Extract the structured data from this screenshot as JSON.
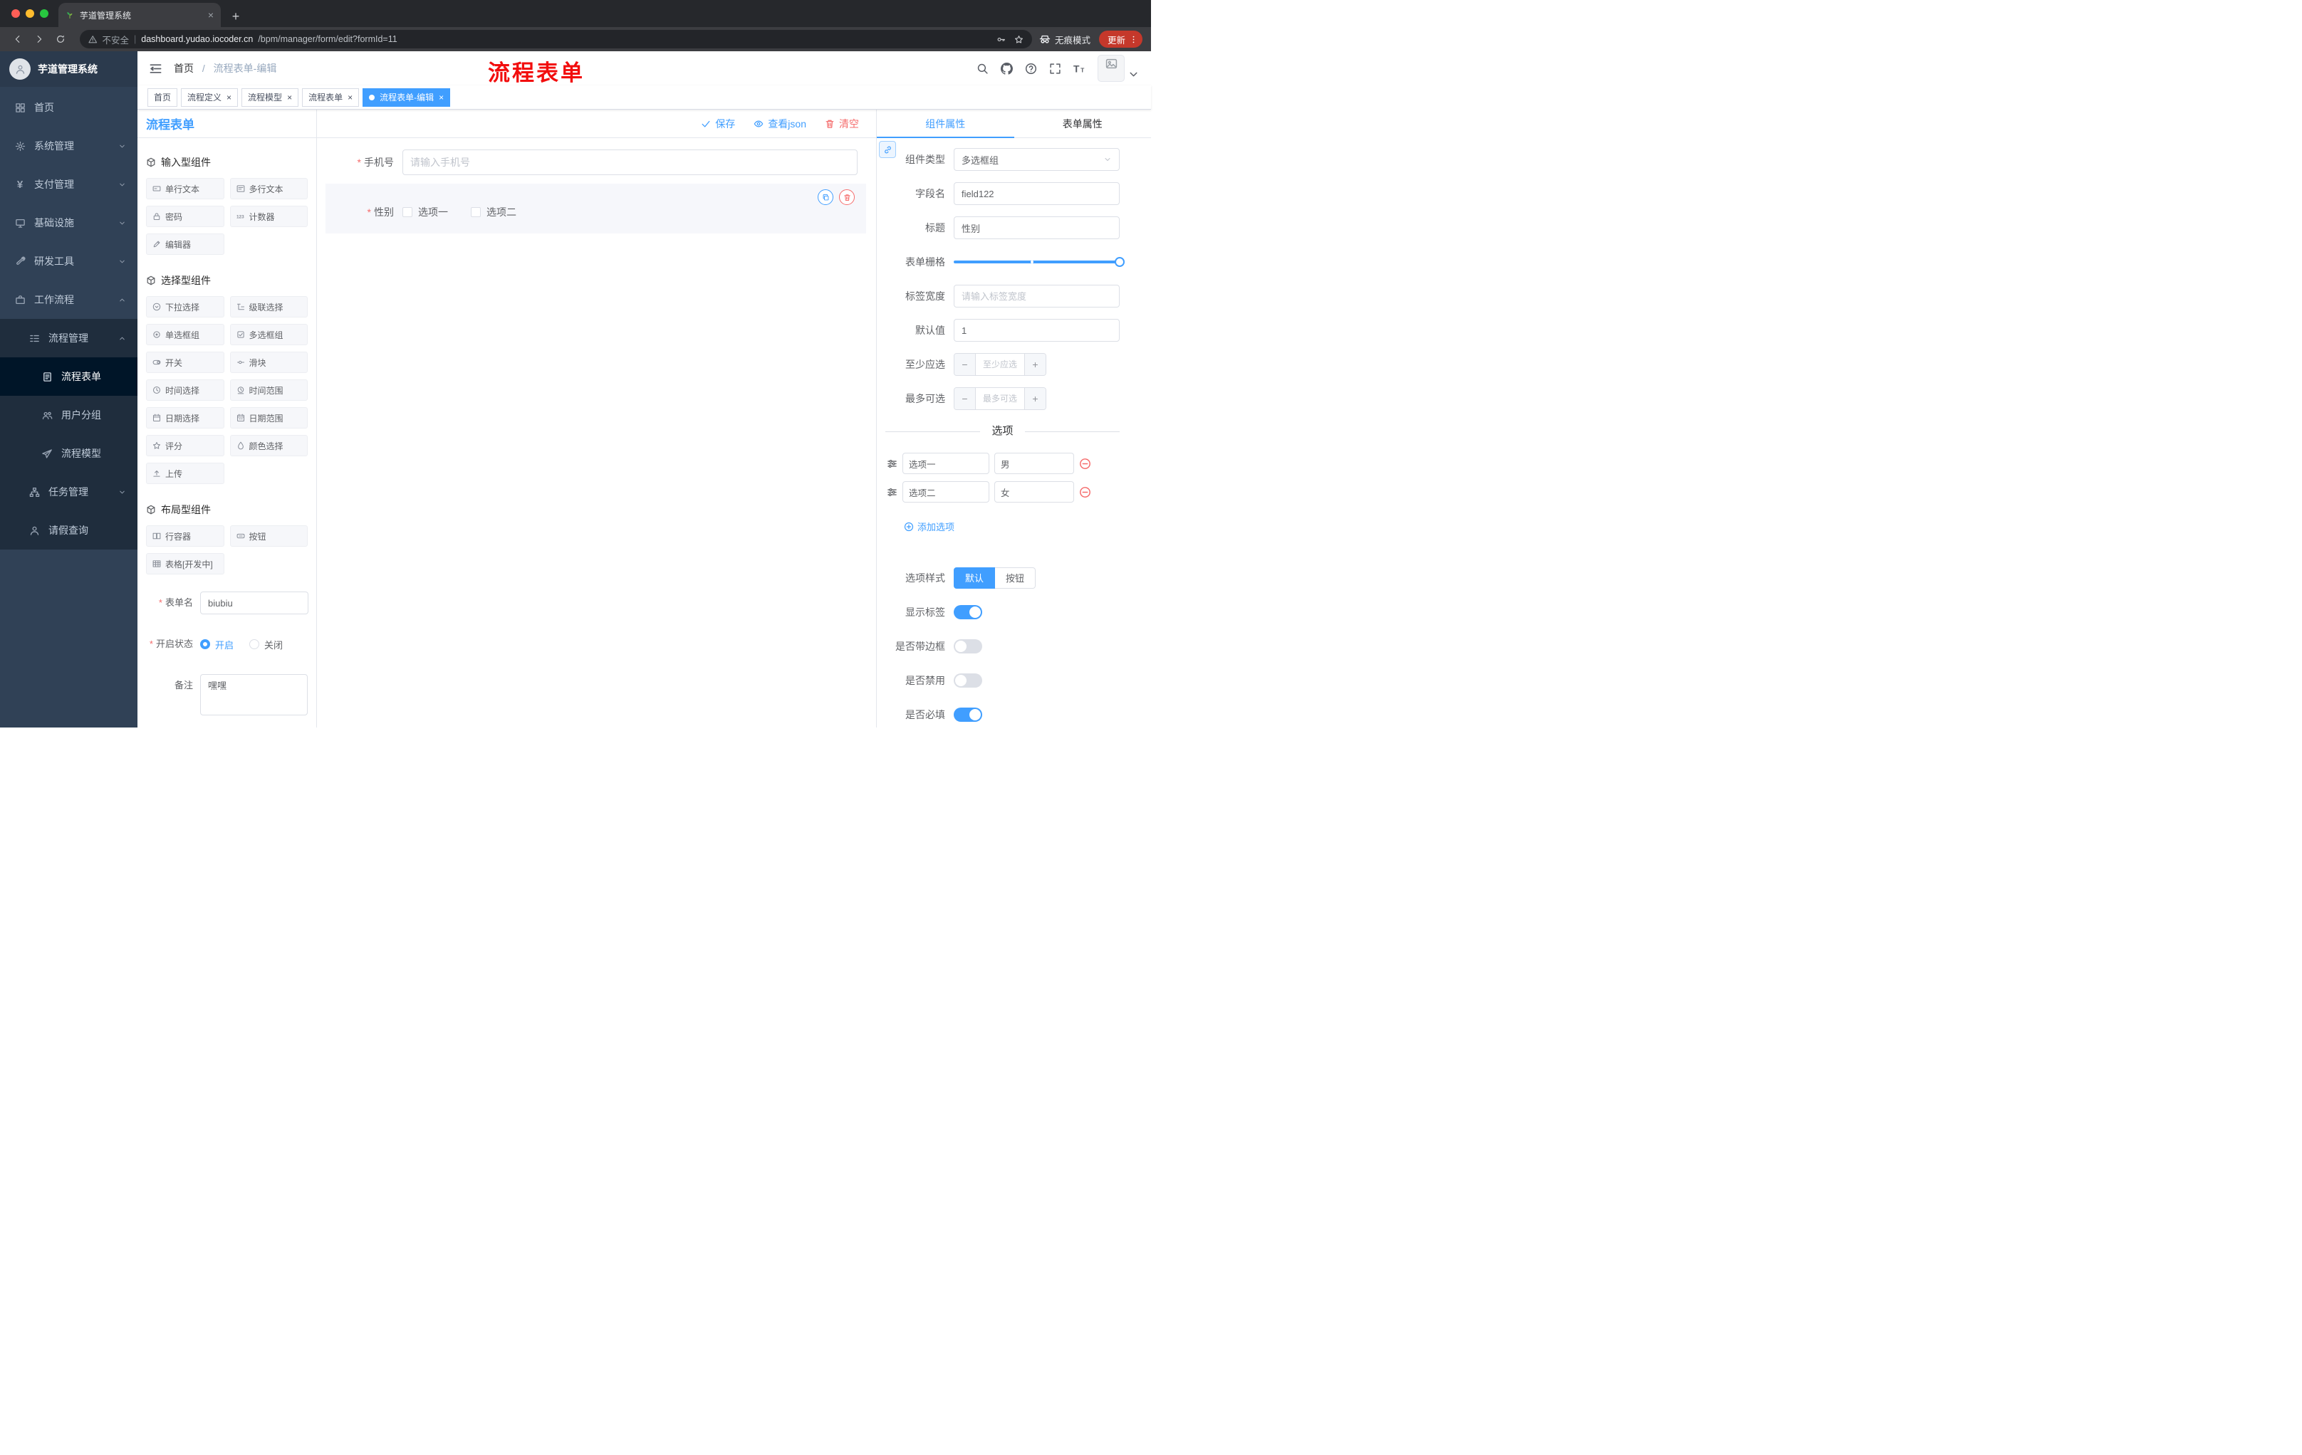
{
  "browser": {
    "tab": {
      "title": "芋道管理系统",
      "favicon": "plant-icon"
    },
    "address": {
      "security": "不安全",
      "url_domain": "dashboard.yudao.iocoder.cn",
      "url_path": "/bpm/manager/form/edit?formId=11"
    },
    "incognito_label": "无痕模式",
    "update_label": "更新"
  },
  "app_header": {
    "breadcrumb": {
      "home": "首页",
      "sep": "/",
      "current": "流程表单-编辑"
    },
    "annotation": "流程表单",
    "icons": [
      "search",
      "github",
      "help",
      "fullscreen",
      "font-size"
    ]
  },
  "tags_view": {
    "tags": [
      {
        "label": "首页",
        "closable": false,
        "active": false
      },
      {
        "label": "流程定义",
        "closable": true,
        "active": false
      },
      {
        "label": "流程模型",
        "closable": true,
        "active": false
      },
      {
        "label": "流程表单",
        "closable": true,
        "active": false
      },
      {
        "label": "流程表单-编辑",
        "closable": true,
        "active": true
      }
    ]
  },
  "sidebar": {
    "logo_title": "芋道管理系统",
    "menu": [
      {
        "label": "首页",
        "icon": "dashboard"
      },
      {
        "label": "系统管理",
        "icon": "gear",
        "expanded": false
      },
      {
        "label": "支付管理",
        "icon": "yen",
        "expanded": false
      },
      {
        "label": "基础设施",
        "icon": "infra",
        "expanded": false
      },
      {
        "label": "研发工具",
        "icon": "tools",
        "expanded": false
      },
      {
        "label": "工作流程",
        "icon": "workflow",
        "expanded": true
      },
      {
        "label": "流程管理",
        "icon": "process",
        "expanded": true
      },
      {
        "label": "流程表单",
        "icon": "form",
        "active": true
      },
      {
        "label": "用户分组",
        "icon": "users"
      },
      {
        "label": "流程模型",
        "icon": "model"
      },
      {
        "label": "任务管理",
        "icon": "tasks",
        "expanded": false
      },
      {
        "label": "请假查询",
        "icon": "person"
      }
    ]
  },
  "designer": {
    "title": "流程表单",
    "actions": {
      "save": "保存",
      "view_json": "查看json",
      "clear": "清空"
    },
    "palette": {
      "groups": [
        {
          "title": "输入型组件",
          "icon": "component",
          "items": [
            {
              "label": "单行文本",
              "icon": "text-field"
            },
            {
              "label": "多行文本",
              "icon": "textarea"
            },
            {
              "label": "密码",
              "icon": "password"
            },
            {
              "label": "计数器",
              "icon": "counter"
            },
            {
              "label": "编辑器",
              "icon": "editor"
            }
          ]
        },
        {
          "title": "选择型组件",
          "icon": "component",
          "items": [
            {
              "label": "下拉选择",
              "icon": "select"
            },
            {
              "label": "级联选择",
              "icon": "cascader"
            },
            {
              "label": "单选框组",
              "icon": "radio-group"
            },
            {
              "label": "多选框组",
              "icon": "checkbox-group"
            },
            {
              "label": "开关",
              "icon": "switch"
            },
            {
              "label": "滑块",
              "icon": "slider"
            },
            {
              "label": "时间选择",
              "icon": "time"
            },
            {
              "label": "时间范围",
              "icon": "time-range"
            },
            {
              "label": "日期选择",
              "icon": "date"
            },
            {
              "label": "日期范围",
              "icon": "date-range"
            },
            {
              "label": "评分",
              "icon": "rate"
            },
            {
              "label": "颜色选择",
              "icon": "color"
            },
            {
              "label": "上传",
              "icon": "upload"
            }
          ]
        },
        {
          "title": "布局型组件",
          "icon": "component",
          "items": [
            {
              "label": "行容器",
              "icon": "row"
            },
            {
              "label": "按钮",
              "icon": "button"
            },
            {
              "label": "表格[开发中]",
              "icon": "table"
            }
          ]
        }
      ]
    },
    "meta_form": {
      "name_label": "表单名",
      "name_value": "biubiu",
      "status_label": "开启状态",
      "status_options": [
        {
          "label": "开启",
          "selected": true
        },
        {
          "label": "关闭",
          "selected": false
        }
      ],
      "remark_label": "备注",
      "remark_value": "嘿嘿"
    },
    "canvas": {
      "phone": {
        "label": "手机号",
        "placeholder": "请输入手机号",
        "required": true
      },
      "gender": {
        "label": "性别",
        "required": true,
        "options": [
          "选项一",
          "选项二"
        ],
        "selected": true
      }
    }
  },
  "props_panel": {
    "tabs": {
      "component": "组件属性",
      "form": "表单属性",
      "component_active": true
    },
    "fields": {
      "type_label": "组件类型",
      "type_value": "多选框组",
      "field_label": "字段名",
      "field_value": "field122",
      "title_label": "标题",
      "title_value": "性别",
      "grid_label": "表单栅格",
      "label_width_label": "标签宽度",
      "label_width_placeholder": "请输入标签宽度",
      "default_label": "默认值",
      "default_value": "1",
      "min_label": "至少应选",
      "min_placeholder": "至少应选",
      "max_label": "最多可选",
      "max_placeholder": "最多可选"
    },
    "options": {
      "divider": "选项",
      "rows": [
        {
          "label": "选项一",
          "value": "男"
        },
        {
          "label": "选项二",
          "value": "女"
        }
      ],
      "add": "添加选项"
    },
    "style": {
      "label": "选项样式",
      "default": "默认",
      "button": "按钮",
      "default_active": true
    },
    "toggles": [
      {
        "label": "显示标签",
        "on": true
      },
      {
        "label": "是否带边框",
        "on": false
      },
      {
        "label": "是否禁用",
        "on": false
      },
      {
        "label": "是否必填",
        "on": true
      }
    ]
  },
  "colors": {
    "accent": "#409eff",
    "danger": "#f56c6c",
    "annotation": "#f20d0d",
    "update_chip": "#c5382b",
    "sidebar_bg": "#304156",
    "submenu_bg": "#1f2d3d"
  }
}
